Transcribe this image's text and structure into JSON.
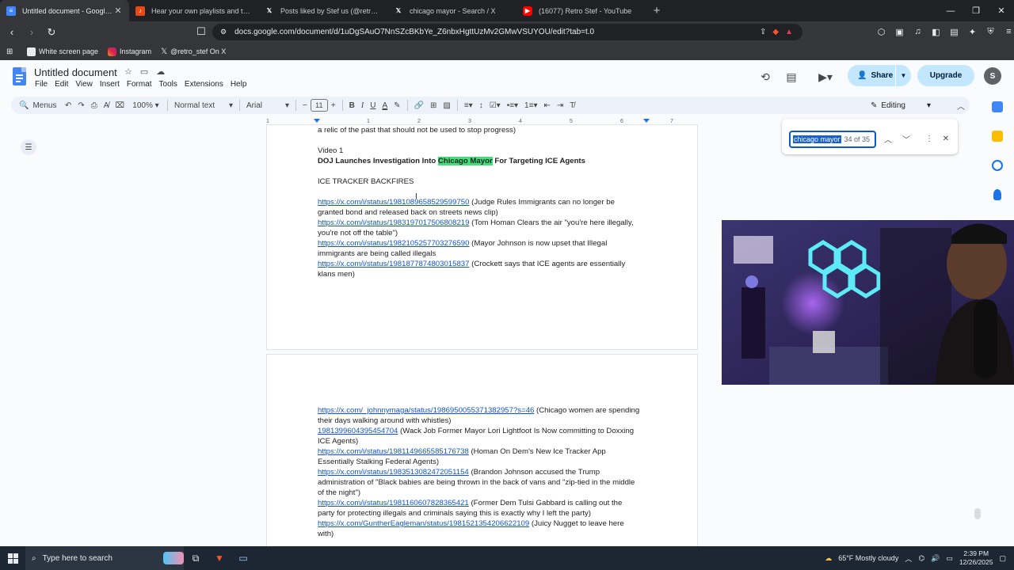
{
  "browser": {
    "tabs": [
      {
        "label": "Untitled document - Google Docs",
        "active": true,
        "favicon": "docs-icon"
      },
      {
        "label": "Hear your own playlists and the play...",
        "active": false,
        "favicon": "music-icon"
      },
      {
        "label": "Posts liked by Stef us (@retro_stef) / X",
        "active": false,
        "favicon": "x-icon"
      },
      {
        "label": "chicago mayor - Search / X",
        "active": false,
        "favicon": "x-icon"
      },
      {
        "label": "(16077) Retro Stef - YouTube",
        "active": false,
        "favicon": "youtube-icon"
      }
    ],
    "url": "docs.google.com/document/d/1uDgSAuO7NnSZcBKbYe_Z6nbxHgttUzMv2GMwVSUYOU/edit?tab=t.0",
    "bookmarks": [
      {
        "label": "White screen page"
      },
      {
        "label": "Instagram"
      },
      {
        "label": "@retro_stef On X"
      }
    ]
  },
  "docs": {
    "title": "Untitled document",
    "menu": [
      "File",
      "Edit",
      "View",
      "Insert",
      "Format",
      "Tools",
      "Extensions",
      "Help"
    ],
    "share_label": "Share",
    "upgrade_label": "Upgrade",
    "avatar_letter": "S",
    "toolbar": {
      "menus_label": "Menus",
      "zoom": "100%",
      "style": "Normal text",
      "font": "Arial",
      "font_size": "11",
      "mode": "Editing"
    },
    "ruler": [
      "1",
      "1",
      "2",
      "3",
      "4",
      "5",
      "6",
      "7"
    ],
    "find": {
      "query": "chicago mayor",
      "count": "34 of 35"
    }
  },
  "page1": {
    "l1": "a relic of the past that should not be used to stop progress)",
    "l2": "Video 1",
    "l3_pre": "DOJ Launches Investigation Into ",
    "l3_hl": "Chicago Mayor",
    "l3_post": " For Targeting ICE Agents",
    "l4": "ICE TRACKER BACKFIRES",
    "links": [
      {
        "url": "https://x.com/i/status/1981089658529599750",
        "desc": " (Judge Rules Immigrants can no longer be",
        "cont": "granted bond and released back on streets news clip)"
      },
      {
        "url": "https://x.com/i/status/1983197017506808219",
        "desc": " (Tom Homan Clears the air \"you're here illegally,",
        "cont": "you're not off the table\")"
      },
      {
        "url": "https://x.com/i/status/1982105257703276590",
        "desc": " (Mayor Johnson is now upset that Illegal",
        "cont": "immigrants are being called illegals"
      },
      {
        "url": "https://x.com/i/status/1981877874803015837",
        "desc": " (Crockett says that ICE agents are essentially",
        "cont": "klans men)"
      }
    ]
  },
  "page2": {
    "links": [
      {
        "url": "https://x.com/_johnnymaga/status/1986950055371382957?s=46",
        "desc": " (Chicago women are spending",
        "cont": [
          "their days walking around with whistles)"
        ]
      },
      {
        "url": "1981399604395454704",
        "desc": " (Wack Job Former Mayor Lori Lightfoot Is Now committing to Doxxing",
        "cont": [
          "ICE Agents)"
        ]
      },
      {
        "url": "https://x.com/i/status/1981149665585176738",
        "desc": " (Homan On Dem's New Ice Tracker App",
        "cont": [
          "Essentially Stalking Federal Agents)"
        ]
      },
      {
        "url": "https://x.com/i/status/1983513082472051154",
        "desc": " (Brandon Johnson  accused the Trump",
        "cont": [
          "administration of  \"Black babies are being thrown in the back of vans and \"zip-tied in the middle",
          "of the night\")"
        ]
      },
      {
        "url": "https://x.com/i/status/1981160607828365421",
        "desc": " (Former Dem Tulsi Gabbard is calling out the",
        "cont": [
          "party for protecting illegals and criminals saying this is exactly why I left the party)"
        ]
      },
      {
        "url": "https://x.com/GuntherEagleman/status/1981521354206622109",
        "desc": " (Juicy Nugget to leave here",
        "cont": [
          "with)"
        ]
      }
    ]
  },
  "taskbar": {
    "search_placeholder": "Type here to search",
    "weather": "65°F  Mostly cloudy",
    "time": "2:39 PM",
    "date": "12/26/2025"
  },
  "colors": {
    "highlight": "#3fe07a",
    "link": "#1155cc",
    "share_bg": "#c2e7ff",
    "browser_dark": "#202124"
  }
}
